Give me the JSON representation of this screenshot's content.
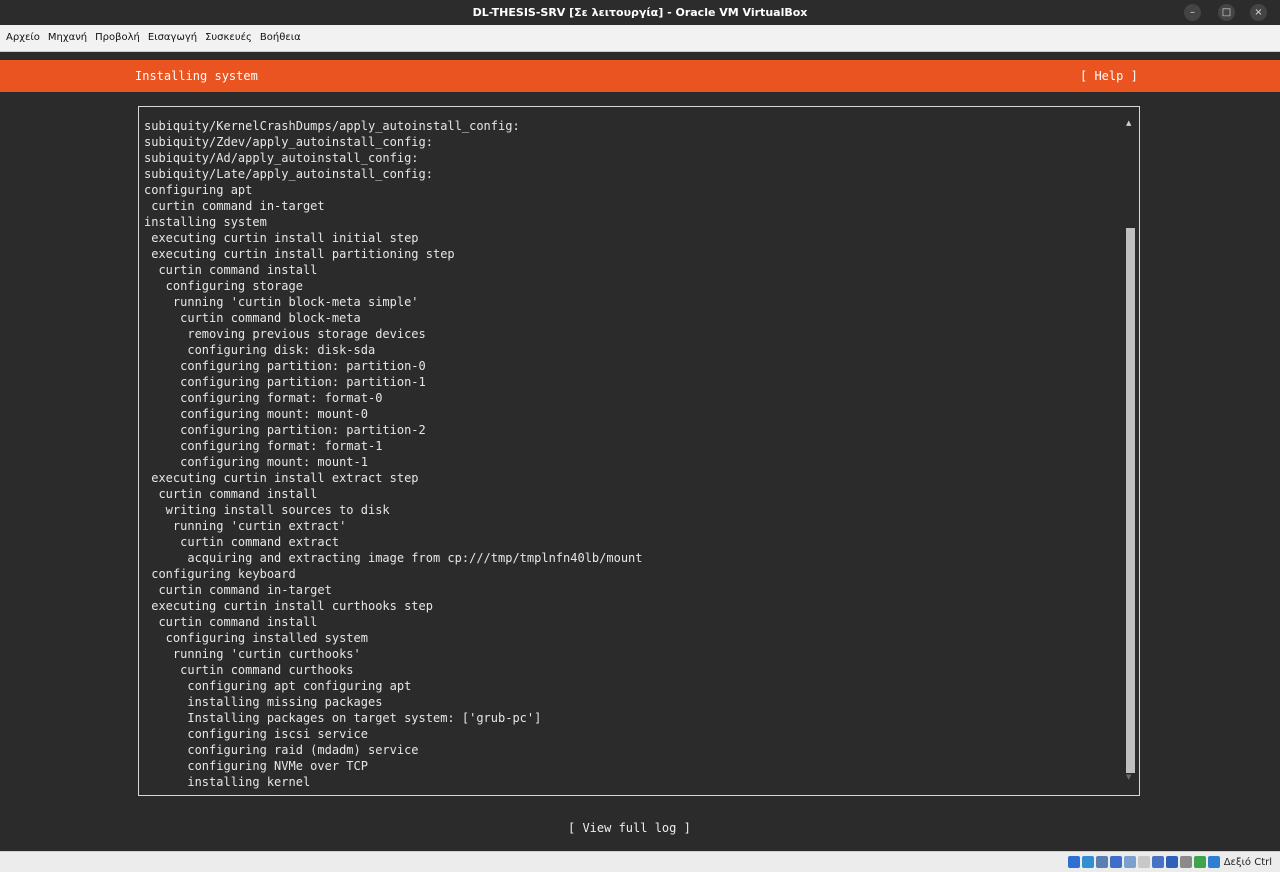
{
  "window": {
    "title": "DL-THESIS-SRV [Σε λειτουργία] - Oracle VM VirtualBox",
    "controls": {
      "minimize": "–",
      "maximize": "□",
      "close": "×"
    }
  },
  "menubar": {
    "items": [
      "Αρχείο",
      "Μηχανή",
      "Προβολή",
      "Εισαγωγή",
      "Συσκευές",
      "Βοήθεια"
    ]
  },
  "installer": {
    "title": "Installing system",
    "help": "[ Help ]",
    "log_lines": [
      "subiquity/KernelCrashDumps/apply_autoinstall_config:",
      "subiquity/Zdev/apply_autoinstall_config:",
      "subiquity/Ad/apply_autoinstall_config:",
      "subiquity/Late/apply_autoinstall_config:",
      "configuring apt",
      " curtin command in-target",
      "installing system",
      " executing curtin install initial step",
      " executing curtin install partitioning step",
      "  curtin command install",
      "   configuring storage",
      "    running 'curtin block-meta simple'",
      "     curtin command block-meta",
      "      removing previous storage devices",
      "      configuring disk: disk-sda",
      "     configuring partition: partition-0",
      "     configuring partition: partition-1",
      "     configuring format: format-0",
      "     configuring mount: mount-0",
      "     configuring partition: partition-2",
      "     configuring format: format-1",
      "     configuring mount: mount-1",
      " executing curtin install extract step",
      "  curtin command install",
      "   writing install sources to disk",
      "    running 'curtin extract'",
      "     curtin command extract",
      "      acquiring and extracting image from cp:///tmp/tmplnfn40lb/mount",
      " configuring keyboard",
      "  curtin command in-target",
      " executing curtin install curthooks step",
      "  curtin command install",
      "   configuring installed system",
      "    running 'curtin curthooks'",
      "     curtin command curthooks",
      "      configuring apt configuring apt",
      "      installing missing packages",
      "      Installing packages on target system: ['grub-pc']",
      "      configuring iscsi service",
      "      configuring raid (mdadm) service",
      "      configuring NVMe over TCP",
      "      installing kernel"
    ],
    "scroll": {
      "up": "▲",
      "down": "▼",
      "position": 0.17
    },
    "view_full_log": "[ View full log ]"
  },
  "statusbar": {
    "icons": [
      "harddisk-icon",
      "optical-disc-icon",
      "audio-icon",
      "network-icon",
      "usb-icon",
      "shared-folder-icon",
      "display-icon",
      "video-capture-icon",
      "cpu-icon",
      "mouse-integration-icon",
      "keyboard-icon"
    ],
    "icon_colors": [
      "#2f6fd1",
      "#2f8fd1",
      "#5a7fb0",
      "#3d6ec9",
      "#7aa0d0",
      "#c8c8c8",
      "#4a72c4",
      "#2f5fb8",
      "#8a8a8a",
      "#3fa34d",
      "#2f7fd1"
    ],
    "host_key": "Δεξιό Ctrl"
  }
}
